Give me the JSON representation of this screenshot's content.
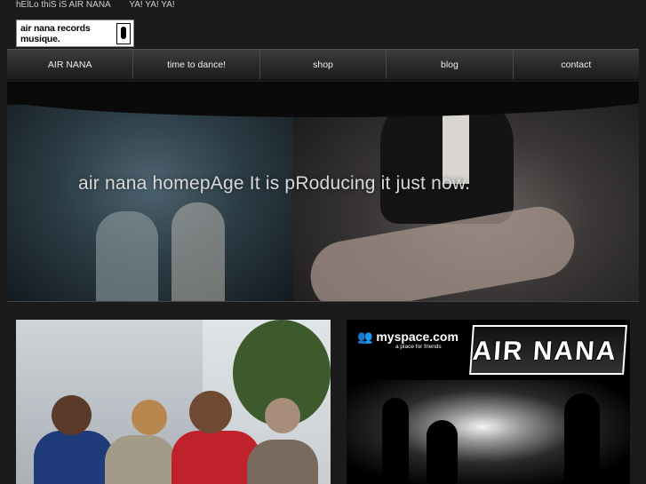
{
  "header": {
    "tagline_1": "hElLo thiS iS AIR NANA",
    "tagline_2": "YA! YA! YA!",
    "logo_text": "air nana records\nmusique."
  },
  "nav": {
    "items": [
      {
        "label": "AIR NANA"
      },
      {
        "label": "time to dance!"
      },
      {
        "label": "shop"
      },
      {
        "label": "blog"
      },
      {
        "label": "contact"
      }
    ]
  },
  "hero": {
    "title": "air nana homepAge It is pRoducing it just now."
  },
  "myspace": {
    "logo": "myspace.com",
    "subtitle": "a place for friends",
    "band_name": "AIR NANA"
  }
}
